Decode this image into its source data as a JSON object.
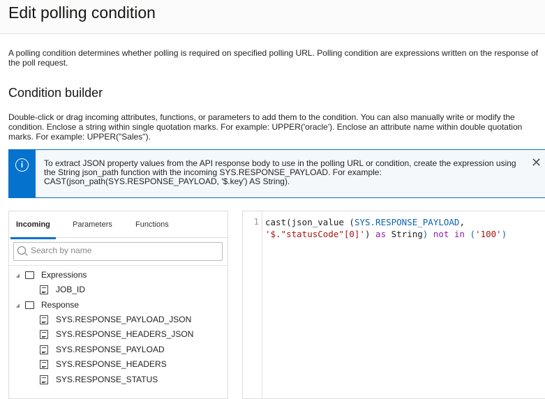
{
  "header": {
    "title": "Edit polling condition"
  },
  "description": "A polling condition determines whether polling is required on specified polling URL. Polling condition are expressions written on the response of the poll request.",
  "builder": {
    "title": "Condition builder",
    "help_line1": "Double-click or drag incoming attributes, functions, or parameters to add them to the condition. You can also manually write or modify the",
    "help_line2": "condition. Enclose a string within single quotation marks. For example: UPPER('oracle'). Enclose an attribute name within double quotation",
    "help_line3": "marks. For example: UPPER(\"Sales\")."
  },
  "banner": {
    "icon": "info-icon",
    "text": "To extract JSON property values from the API response body to use in the polling URL or condition, create the expression using the String json_path function with the incoming SYS.RESPONSE_PAYLOAD. For example: CAST(json_path(SYS.RESPONSE_PAYLOAD, '$.key') AS String).",
    "close": "✕"
  },
  "panel": {
    "tabs": [
      {
        "label": "Incoming"
      },
      {
        "label": "Parameters"
      },
      {
        "label": "Functions"
      }
    ],
    "search_placeholder": "Search by name",
    "tree": {
      "expressions": {
        "label": "Expressions",
        "items": [
          "JOB_ID"
        ]
      },
      "response": {
        "label": "Response",
        "items": [
          "SYS.RESPONSE_PAYLOAD_JSON",
          "SYS.RESPONSE_HEADERS_JSON",
          "SYS.RESPONSE_PAYLOAD",
          "SYS.RESPONSE_HEADERS",
          "SYS.RESPONSE_STATUS"
        ]
      }
    }
  },
  "editor": {
    "line_number": "1",
    "tokens": {
      "t1": "cast(json_value (",
      "t2": "SYS.RESPONSE_PAYLOAD",
      ",": ",",
      "t3": "'$.\"statusCode\"[0]'",
      "t4": ")",
      "t5": " as ",
      "t6": "String",
      ")": ")",
      "t7": " not in ",
      "t8": "(",
      "t9": "'100'",
      "t10": ")"
    }
  }
}
